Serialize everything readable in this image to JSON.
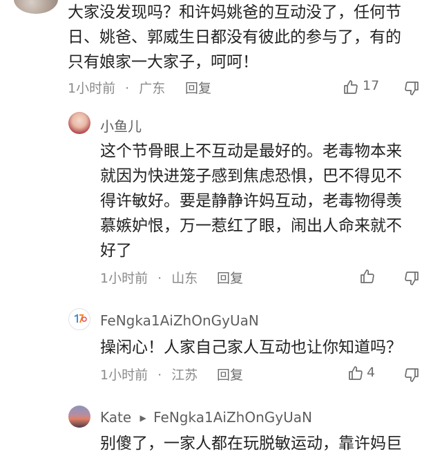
{
  "comments": [
    {
      "lines": [
        "大家没发现吗？和许妈姚爸的互动没了，任何节",
        "日、姚爸、郭威生日都没有彼此的参与了，有的",
        "只有娘家一大家子，呵呵！"
      ],
      "time": "1小时前",
      "location": "广东",
      "reply": "回复",
      "likes": "17"
    },
    {
      "name": "小鱼儿",
      "lines": [
        "这个节骨眼上不互动是最好的。老毒物本来",
        "就因为快进笼子感到焦虑恐惧，巴不得见不",
        "得许敏好。要是静静许妈互动，老毒物得羡",
        "慕嫉妒恨，万一惹红了眼，闹出人命来就不",
        "好了"
      ],
      "time": "1小时前",
      "location": "山东",
      "reply": "回复",
      "likes": ""
    },
    {
      "name": "FeNgka1AiZhOnGyUaN",
      "lines": [
        "操闲心！人家自己家人互动也让你知道吗？"
      ],
      "time": "1小时前",
      "location": "江苏",
      "reply": "回复",
      "likes": "4"
    },
    {
      "name": "Kate",
      "reply_to": "FeNgka1AiZhOnGyUaN",
      "lines": [
        "别傻了，一家人都在玩脱敏运动，靠许妈巨"
      ]
    }
  ],
  "separator": "·",
  "icons": {
    "like": "thumbs-up-icon",
    "dislike": "thumbs-down-icon",
    "arrow": "reply-arrow-icon"
  }
}
